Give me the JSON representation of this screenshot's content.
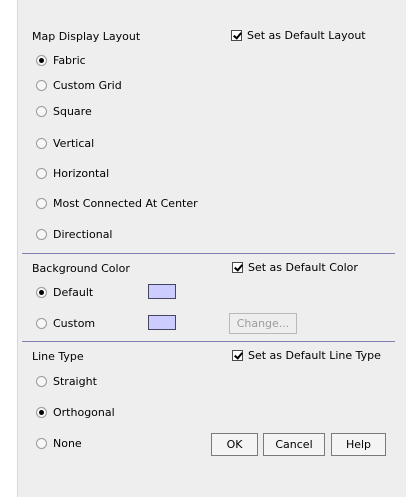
{
  "map_layout": {
    "heading": "Map Display Layout",
    "default_checkbox": {
      "label": "Set as Default Layout",
      "checked": true
    },
    "options": [
      {
        "label": "Fabric",
        "selected": true
      },
      {
        "label": "Custom Grid",
        "selected": false
      },
      {
        "label": "Square",
        "selected": false
      },
      {
        "label": "Vertical",
        "selected": false
      },
      {
        "label": "Horizontal",
        "selected": false
      },
      {
        "label": "Most Connected At Center",
        "selected": false
      },
      {
        "label": "Directional",
        "selected": false
      }
    ]
  },
  "background_color": {
    "heading": "Background Color",
    "default_checkbox": {
      "label": "Set as Default Color",
      "checked": true
    },
    "options": [
      {
        "label": "Default",
        "selected": true,
        "swatch_color": "#ccccff"
      },
      {
        "label": "Custom",
        "selected": false,
        "swatch_color": "#ccccff"
      }
    ],
    "change_button": {
      "label": "Change...",
      "enabled": false
    }
  },
  "line_type": {
    "heading": "Line Type",
    "default_checkbox": {
      "label": "Set as Default Line Type",
      "checked": true
    },
    "options": [
      {
        "label": "Straight",
        "selected": false
      },
      {
        "label": "Orthogonal",
        "selected": true
      },
      {
        "label": "None",
        "selected": false
      }
    ]
  },
  "footer": {
    "ok_label": "OK",
    "cancel_label": "Cancel",
    "help_label": "Help"
  },
  "colors": {
    "panel_bg": "#eeeeee",
    "separator": "#7d7fb0",
    "swatch": "#ccccff"
  }
}
